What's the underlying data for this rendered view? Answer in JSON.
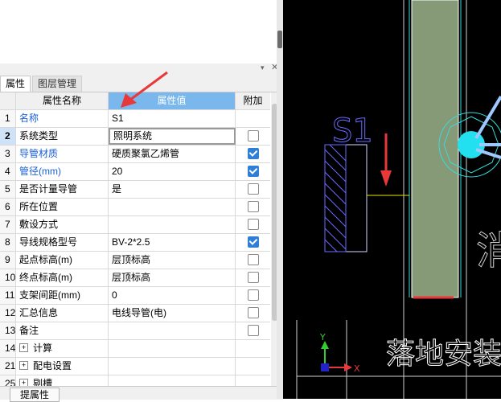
{
  "tabs": {
    "properties": "属性",
    "layers": "图层管理"
  },
  "header": {
    "num": "",
    "name": "属性名称",
    "value": "属性值",
    "add": "附加"
  },
  "rows": [
    {
      "num": "1",
      "name": "名称",
      "value": "S1",
      "blue": true,
      "checkbox": "none"
    },
    {
      "num": "2",
      "name": "系统类型",
      "value": "照明系统",
      "blue": false,
      "checkbox": "off"
    },
    {
      "num": "3",
      "name": "导管材质",
      "value": "硬质聚氯乙烯管",
      "blue": true,
      "checkbox": "on"
    },
    {
      "num": "4",
      "name": "管径(mm)",
      "value": "20",
      "blue": true,
      "checkbox": "on"
    },
    {
      "num": "5",
      "name": "是否计量导管",
      "value": "是",
      "blue": false,
      "checkbox": "off"
    },
    {
      "num": "6",
      "name": "所在位置",
      "value": "",
      "blue": false,
      "checkbox": "off"
    },
    {
      "num": "7",
      "name": "敷设方式",
      "value": "",
      "blue": false,
      "checkbox": "off"
    },
    {
      "num": "8",
      "name": "导线规格型号",
      "value": "BV-2*2.5",
      "blue": false,
      "checkbox": "on"
    },
    {
      "num": "9",
      "name": "起点标高(m)",
      "value": "层顶标高",
      "blue": false,
      "checkbox": "off"
    },
    {
      "num": "10",
      "name": "终点标高(m)",
      "value": "层顶标高",
      "blue": false,
      "checkbox": "off"
    },
    {
      "num": "11",
      "name": "支架间距(mm)",
      "value": "0",
      "blue": false,
      "checkbox": "off"
    },
    {
      "num": "12",
      "name": "汇总信息",
      "value": "电线导管(电)",
      "blue": false,
      "checkbox": "off"
    },
    {
      "num": "13",
      "name": "备注",
      "value": "",
      "blue": false,
      "checkbox": "off"
    }
  ],
  "groups": [
    {
      "num": "14",
      "name": "计算"
    },
    {
      "num": "21",
      "name": "配电设置"
    },
    {
      "num": "25",
      "name": "剔槽"
    }
  ],
  "bottom": {
    "extract_button": "提属性"
  },
  "cad": {
    "label_s1": "S1",
    "text_floor": "落地安装",
    "text_partial": "消",
    "axis_x": "X",
    "axis_y": "Y"
  },
  "colors": {
    "header_value_bg": "#7ab7ec",
    "link_blue": "#1a5fd6",
    "checkbox_on": "#2f7fd6",
    "annotation_arrow": "#e8393a",
    "cad_bg": "#000000"
  }
}
